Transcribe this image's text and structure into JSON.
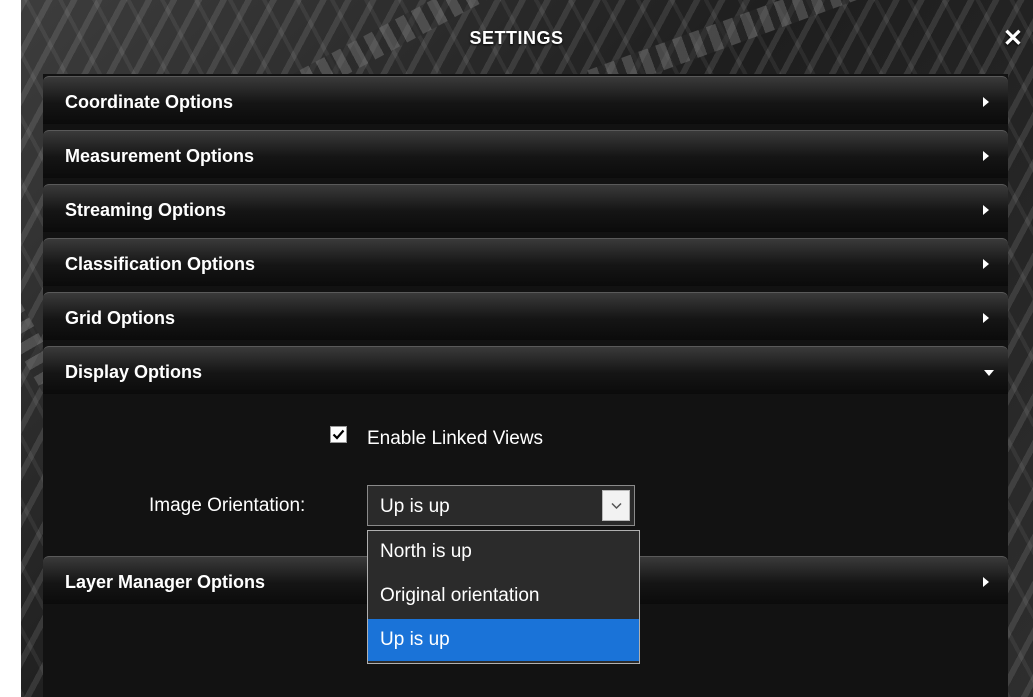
{
  "window": {
    "title": "SETTINGS",
    "close_symbol": "✕"
  },
  "sections": {
    "coordinate": {
      "label": "Coordinate Options",
      "expanded": false
    },
    "measurement": {
      "label": "Measurement Options",
      "expanded": false
    },
    "streaming": {
      "label": "Streaming Options",
      "expanded": false
    },
    "classification": {
      "label": "Classification Options",
      "expanded": false
    },
    "grid": {
      "label": "Grid Options",
      "expanded": false
    },
    "display": {
      "label": "Display Options",
      "expanded": true
    },
    "layer_manager": {
      "label": "Layer Manager Options",
      "expanded": false
    }
  },
  "display_options": {
    "linked_views": {
      "label": "Enable Linked Views",
      "checked": true
    },
    "image_orientation": {
      "label": "Image Orientation:",
      "value": "Up is up",
      "options": [
        "North is up",
        "Original orientation",
        "Up is up"
      ],
      "highlighted": "Up is up"
    }
  },
  "icons": {
    "collapsed": "chevron-right-icon",
    "expanded": "chevron-down-icon",
    "close": "close-icon",
    "check": "checkmark-icon"
  },
  "colors": {
    "highlight": "#1a73d8",
    "panel": "#121212",
    "text": "#ffffff"
  }
}
